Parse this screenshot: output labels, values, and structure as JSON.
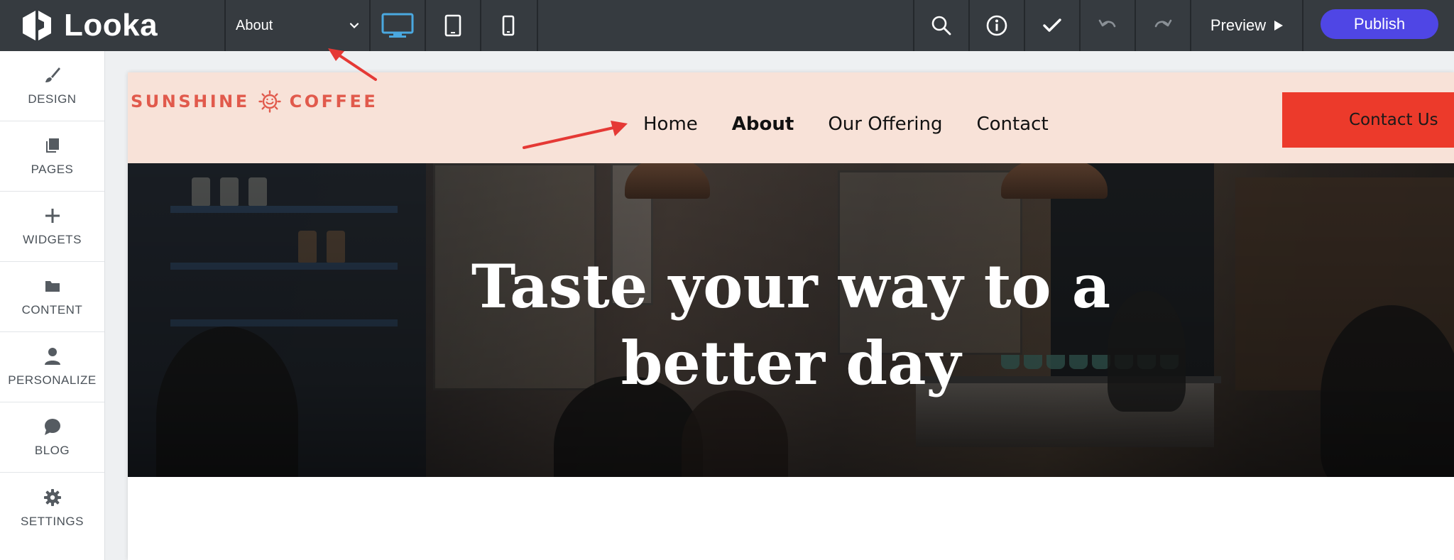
{
  "app": {
    "name": "Looka"
  },
  "toolbar": {
    "page_selector": {
      "selected": "About"
    },
    "devices": [
      "desktop",
      "tablet",
      "mobile"
    ],
    "active_device": "desktop",
    "tools": [
      "search",
      "info",
      "check",
      "undo",
      "redo"
    ],
    "preview_label": "Preview",
    "publish_label": "Publish"
  },
  "sidebar": {
    "items": [
      {
        "label": "DESIGN",
        "icon": "brush-icon"
      },
      {
        "label": "PAGES",
        "icon": "pages-icon"
      },
      {
        "label": "WIDGETS",
        "icon": "plus-icon"
      },
      {
        "label": "CONTENT",
        "icon": "folder-icon"
      },
      {
        "label": "PERSONALIZE",
        "icon": "person-icon"
      },
      {
        "label": "BLOG",
        "icon": "chat-bubble-icon"
      },
      {
        "label": "SETTINGS",
        "icon": "gear-icon"
      }
    ]
  },
  "site": {
    "brand": {
      "left": "SUNSHINE",
      "right": "COFFEE",
      "icon": "sun-icon"
    },
    "nav": [
      {
        "label": "Home",
        "active": false
      },
      {
        "label": "About",
        "active": true
      },
      {
        "label": "Our Offering",
        "active": false
      },
      {
        "label": "Contact",
        "active": false
      }
    ],
    "cta_label": "Contact Us",
    "hero_title": "Taste your way to a better day"
  },
  "colors": {
    "topbar": "#363b40",
    "accent_device": "#4aa8e0",
    "publish": "#4f46e5",
    "header_bg": "#f8e2d8",
    "brand": "#e15a4c",
    "cta": "#ec3a2b",
    "annotation_arrow": "#e53935"
  }
}
